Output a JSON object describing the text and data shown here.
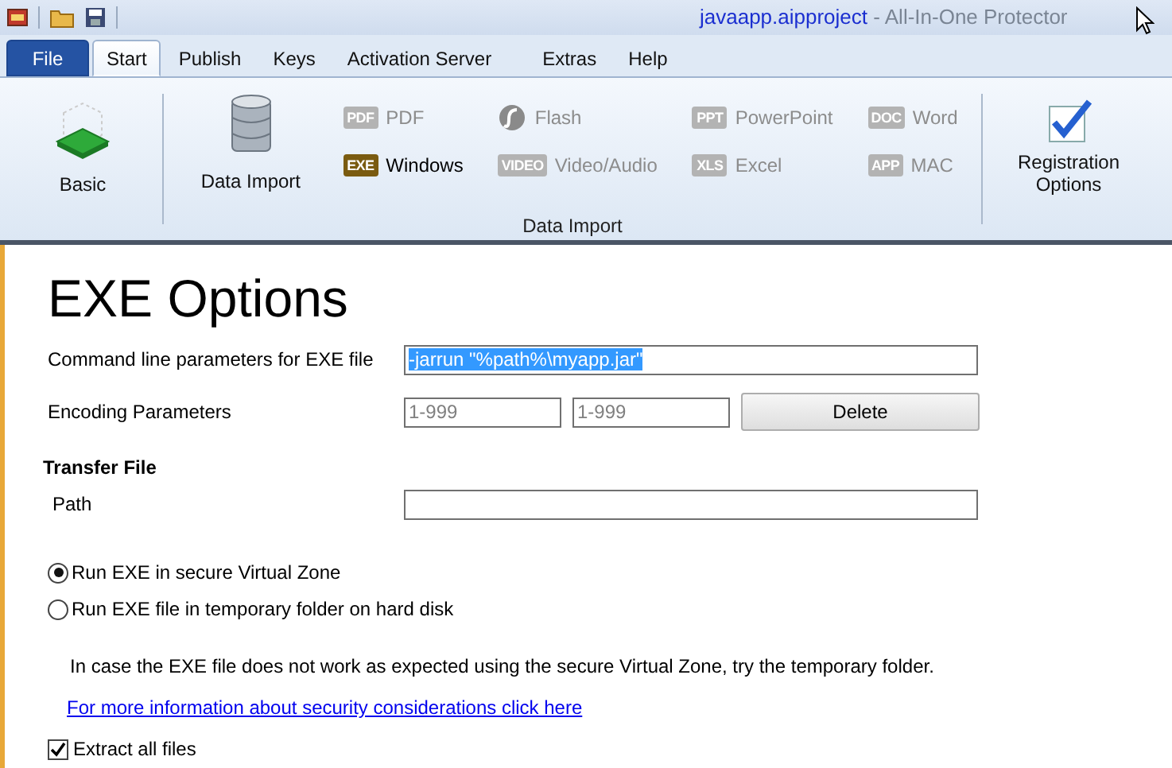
{
  "title_bar": {
    "document": "javaapp.aipproject",
    "app": "- All-In-One Protector"
  },
  "tabs": [
    {
      "label": "File",
      "kind": "file",
      "selected": false
    },
    {
      "label": "Start",
      "kind": "tab",
      "selected": true
    },
    {
      "label": "Publish",
      "kind": "tab",
      "selected": false
    },
    {
      "label": "Keys",
      "kind": "tab",
      "selected": false
    },
    {
      "label": "Activation Server",
      "kind": "tab",
      "selected": false
    },
    {
      "label": "Extras",
      "kind": "tab",
      "selected": false
    },
    {
      "label": "Help",
      "kind": "tab",
      "selected": false
    }
  ],
  "ribbon": {
    "basic": {
      "label": "Basic"
    },
    "data_import": {
      "label": "Data Import",
      "group_label": "Data Import",
      "items": [
        {
          "label": "PDF",
          "kind": "badge",
          "badge": "PDF",
          "disabled": true
        },
        {
          "label": "Flash",
          "kind": "flash",
          "disabled": true
        },
        {
          "label": "PowerPoint",
          "kind": "badge",
          "badge": "PPT",
          "disabled": true
        },
        {
          "label": "Word",
          "kind": "badge",
          "badge": "DOC",
          "disabled": true
        },
        {
          "label": "Windows",
          "kind": "badge",
          "badge": "EXE",
          "disabled": false
        },
        {
          "label": "Video/Audio",
          "kind": "badge",
          "badge": "VIDEO",
          "disabled": true
        },
        {
          "label": "Excel",
          "kind": "badge",
          "badge": "XLS",
          "disabled": true
        },
        {
          "label": "MAC",
          "kind": "badge",
          "badge": "APP",
          "disabled": true
        }
      ]
    },
    "registration": {
      "label": "Registration Options"
    }
  },
  "page": {
    "heading": "EXE Options",
    "command_line": {
      "label": "Command line parameters for EXE file",
      "value": "-jarrun \"%path%\\myapp.jar\"",
      "highlighted": true
    },
    "encoding": {
      "label": "Encoding Parameters",
      "fields": [
        {
          "placeholder": "1-999"
        },
        {
          "placeholder": "1-999"
        }
      ],
      "button": "Delete"
    },
    "transfer_heading": "Transfer File",
    "path": {
      "label": "Path"
    },
    "run_options": [
      {
        "label": "Run EXE in secure Virtual Zone",
        "selected": true
      },
      {
        "label": "Run EXE file in temporary folder on hard disk",
        "selected": false
      }
    ],
    "note": "In case the EXE file does not work as expected using the secure Virtual Zone, try the temporary folder.",
    "link": "For more information about security considerations click here",
    "extract": {
      "label": "Extract all files",
      "checked": true
    }
  }
}
